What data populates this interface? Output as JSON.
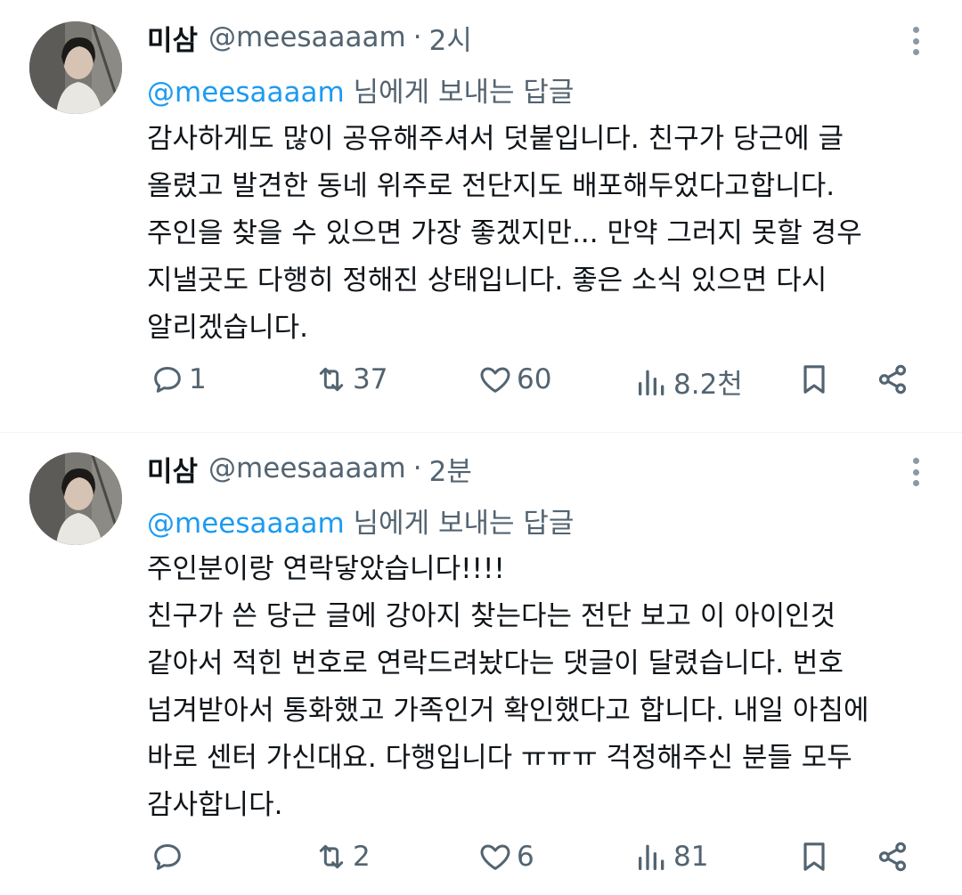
{
  "tweets": [
    {
      "name": "미삼",
      "handle": "@meesaaaam",
      "dot": "·",
      "time": "2시",
      "reply_mention": "@meesaaaam",
      "reply_suffix": " 님에게 보내는 답글",
      "lines": [
        "감사하게도 많이 공유해주셔서 덧붙입니다. 친구가 당근에 글",
        "올렸고 발견한 동네 위주로 전단지도 배포해두었다고합니다.",
        "주인을 찾을 수 있으면 가장 좋겠지만... 만약 그러지 못할 경우",
        "지낼곳도 다행히 정해진 상태입니다. 좋은 소식 있으면 다시",
        "알리겠습니다."
      ],
      "replies": "1",
      "retweets": "37",
      "likes": "60",
      "views": "8.2천"
    },
    {
      "name": "미삼",
      "handle": "@meesaaaam",
      "dot": "·",
      "time": "2분",
      "reply_mention": "@meesaaaam",
      "reply_suffix": " 님에게 보내는 답글",
      "lines": [
        "주인분이랑 연락닿았습니다!!!!",
        "친구가 쓴 당근 글에 강아지 찾는다는 전단 보고 이 아이인것",
        "같아서 적힌 번호로 연락드려놨다는 댓글이 달렸습니다. 번호",
        "넘겨받아서 통화했고 가족인거 확인했다고 합니다. 내일 아침에",
        "바로 센터 가신대요. 다행입니다 ㅠㅠㅠ 걱정해주신 분들 모두",
        "감사합니다."
      ],
      "replies": "",
      "retweets": "2",
      "likes": "6",
      "views": "81"
    }
  ],
  "icons": {
    "reply": "reply-icon",
    "retweet": "retweet-icon",
    "like": "heart-icon",
    "views": "views-icon",
    "bookmark": "bookmark-icon",
    "share": "share-icon",
    "more": "more-icon"
  },
  "colors": {
    "text": "#0f1419",
    "secondary": "#536471",
    "mention": "#1d9bf0",
    "divider": "#eff3f4"
  }
}
